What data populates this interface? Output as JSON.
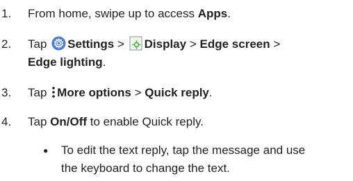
{
  "steps": [
    {
      "number": "1.",
      "text_before": "From home, swipe up to access ",
      "bold": "Apps",
      "text_after": "."
    },
    {
      "number": "2.",
      "tap": "Tap",
      "settings": "Settings",
      "sep1": ">",
      "display": "Display",
      "sep2": ">",
      "edge_screen": "Edge screen",
      "sep3": ">",
      "edge_lighting": "Edge lighting",
      "period": "."
    },
    {
      "number": "3.",
      "tap": "Tap",
      "more_options": "More options",
      "sep": ">",
      "quick_reply": "Quick reply",
      "period": "."
    },
    {
      "number": "4.",
      "tap": "Tap",
      "on_off": "On/Off",
      "text_after": " to enable Quick reply."
    }
  ],
  "bullet": {
    "symbol": "●",
    "line1": "To edit the text reply, tap the message and use",
    "line2": "the keyboard to change the text."
  },
  "icons": {
    "settings_icon_color": "#4a7fd6",
    "display_icon_color": "#3fae3b",
    "more_options_color": "#231f20"
  }
}
